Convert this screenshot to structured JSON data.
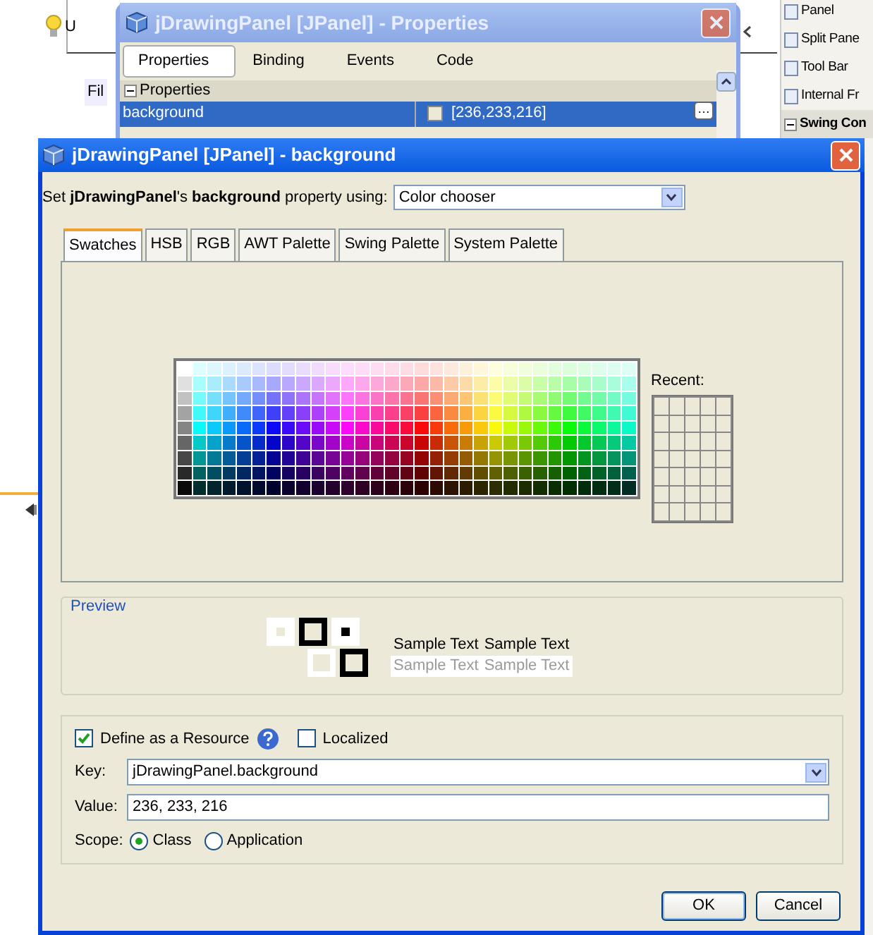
{
  "ide": {
    "hint_text": "U",
    "file_tab": "Fil",
    "palette": [
      {
        "label": "Panel"
      },
      {
        "label": "Split Pane"
      },
      {
        "label": "Tool Bar"
      },
      {
        "label": "Internal Fr"
      }
    ],
    "palette_section": "Swing Con"
  },
  "properties_window": {
    "title": "jDrawingPanel [JPanel] - Properties",
    "tabs": [
      {
        "label": "Properties",
        "selected": true
      },
      {
        "label": "Binding",
        "selected": false
      },
      {
        "label": "Events",
        "selected": false
      },
      {
        "label": "Code",
        "selected": false
      }
    ],
    "section": "Properties",
    "rows": [
      {
        "name": "background",
        "value": "[236,233,216]",
        "button_label": "…",
        "selected": true
      }
    ]
  },
  "dialog": {
    "title": "jDrawingPanel [JPanel] - background",
    "intro": "Set **jDrawingPanel**'s **background** property using:",
    "editor_select": "Color chooser",
    "tabs": [
      {
        "label": "Swatches",
        "selected": true
      },
      {
        "label": "HSB",
        "selected": false
      },
      {
        "label": "RGB",
        "selected": false
      },
      {
        "label": "AWT Palette",
        "selected": false
      },
      {
        "label": "Swing Palette",
        "selected": false
      },
      {
        "label": "System Palette",
        "selected": false
      }
    ],
    "recent_label": "Recent:",
    "preview_label": "Preview",
    "sample_rows": [
      {
        "kind": "dark",
        "texts": [
          "Sample Text",
          "Sample Text"
        ]
      },
      {
        "kind": "light",
        "texts": [
          "Sample Text",
          "Sample Text"
        ]
      }
    ],
    "define_resource": {
      "label": "Define as a Resource",
      "checked": true
    },
    "localized": {
      "label": "Localized",
      "checked": false
    },
    "key_label": "Key:",
    "key_value": "jDrawingPanel.background",
    "value_label": "Value:",
    "value": "236, 233, 216",
    "scope_label": "Scope:",
    "scope_options": [
      {
        "label": "Class",
        "selected": true
      },
      {
        "label": "Application",
        "selected": false
      }
    ],
    "buttons": [
      "OK",
      "Cancel"
    ]
  }
}
